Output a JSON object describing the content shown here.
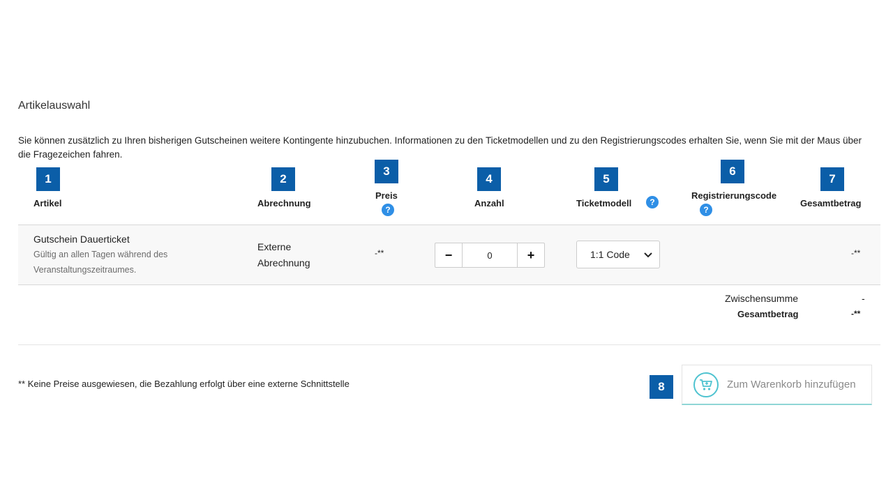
{
  "section": {
    "title": "Artikelauswahl",
    "intro": "Sie können zusätzlich zu Ihren bisherigen Gutscheinen weitere Kontingente hinzubuchen. Informationen zu den Ticketmodellen und zu den Registrierungscodes erhalten Sie, wenn Sie mit der Maus über die Fragezeichen fahren."
  },
  "badges": [
    "1",
    "2",
    "3",
    "4",
    "5",
    "6",
    "7",
    "8"
  ],
  "table": {
    "headers": {
      "artikel": "Artikel",
      "abrechnung": "Abrechnung",
      "preis": "Preis",
      "anzahl": "Anzahl",
      "ticketmodell": "Ticketmodell",
      "registrierungscode": "Registrierungscode",
      "gesamtbetrag": "Gesamtbetrag"
    },
    "help_glyph": "?",
    "row": {
      "name": "Gutschein Dauerticket",
      "desc_line1": "Gültig an allen Tagen während des",
      "desc_line2": "Veranstaltungszeitraumes.",
      "abrechnung_line1": "Externe",
      "abrechnung_line2": "Abrechnung",
      "preis": "-**",
      "quantity": "0",
      "minus": "−",
      "plus": "+",
      "ticketmodell": "1:1 Code",
      "gesamtbetrag": "-**"
    }
  },
  "totals": {
    "subtotal_label": "Zwischensumme",
    "subtotal_value": "-",
    "total_label": "Gesamtbetrag",
    "total_value": "-**"
  },
  "footnote": "** Keine Preise ausgewiesen, die Bezahlung erfolgt über eine externe Schnittstelle",
  "cart_button": {
    "label": "Zum Warenkorb hinzufügen",
    "icon": "cart-icon"
  },
  "colors": {
    "badge": "#0b5ea8",
    "help": "#2f8fe6",
    "cart_accent": "#4fc3d0"
  }
}
